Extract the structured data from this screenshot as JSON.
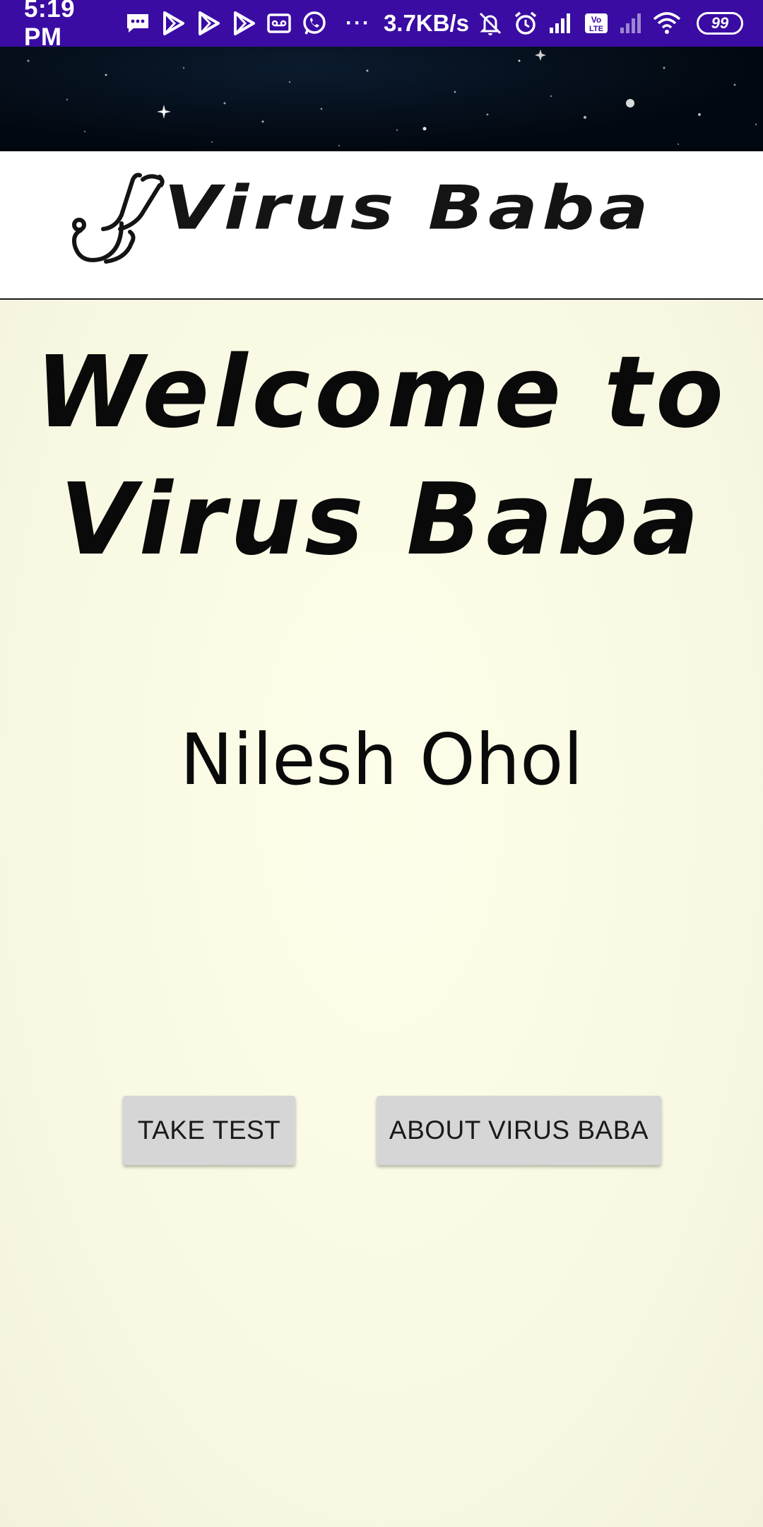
{
  "status_bar": {
    "time": "5:19 PM",
    "net_speed": "3.7KB/s",
    "dots": "···",
    "battery": "99",
    "left_icons": [
      "messages-icon",
      "play-store-icon",
      "play-store-icon",
      "play-store-icon",
      "voicemail-icon",
      "whatsapp-icon"
    ],
    "right_icons": [
      "notifications-off-icon",
      "alarm-icon",
      "signal-icon",
      "volte-icon",
      "signal-icon",
      "wifi-icon"
    ]
  },
  "header": {
    "logo_text": "Virus Baba",
    "logo_icon": "stethoscope-icon"
  },
  "main": {
    "welcome_line1": "Welcome to",
    "welcome_line2": "Virus Baba",
    "user_name": "Nilesh Ohol",
    "take_test_label": "TAKE TEST",
    "about_label": "ABOUT VIRUS BABA"
  },
  "colors": {
    "status_bar": "#3a0ca3",
    "background": "#fbfbe6",
    "button": "#d6d6d6",
    "text": "#0a0a0a"
  }
}
